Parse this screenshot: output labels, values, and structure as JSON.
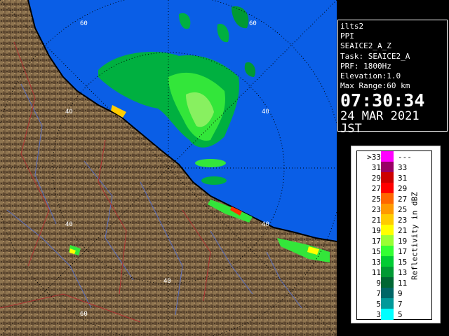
{
  "info": {
    "station": "ilts2",
    "product": "PPI",
    "volume": "SEAICE2_A_Z",
    "task": "Task: SEAICE2_A",
    "prf": "PRF: 1800Hz",
    "elevation": "Elevation:1.0",
    "max_range": "Max Range:60 km",
    "time": "07:30:34",
    "date": "24 MAR 2021 JST"
  },
  "range_labels": [
    "60",
    "60",
    "40",
    "40",
    "40",
    "40",
    "40",
    "60"
  ],
  "legend": {
    "title": "Reflectivity in dBZ",
    "rows": [
      {
        "lo": ">33",
        "hi": "---",
        "color": "#ff00ff"
      },
      {
        "lo": "31",
        "hi": "33",
        "color": "#990066"
      },
      {
        "lo": "29",
        "hi": "31",
        "color": "#cc0000"
      },
      {
        "lo": "27",
        "hi": "29",
        "color": "#ff0000"
      },
      {
        "lo": "25",
        "hi": "27",
        "color": "#ff6600"
      },
      {
        "lo": "23",
        "hi": "25",
        "color": "#ff9900"
      },
      {
        "lo": "21",
        "hi": "23",
        "color": "#ffcc00"
      },
      {
        "lo": "19",
        "hi": "21",
        "color": "#ffff00"
      },
      {
        "lo": "17",
        "hi": "19",
        "color": "#99ff33"
      },
      {
        "lo": "15",
        "hi": "17",
        "color": "#33ff33"
      },
      {
        "lo": "13",
        "hi": "15",
        "color": "#00cc33"
      },
      {
        "lo": "11",
        "hi": "13",
        "color": "#009933"
      },
      {
        "lo": "9",
        "hi": "11",
        "color": "#006633"
      },
      {
        "lo": "7",
        "hi": "9",
        "color": "#006666"
      },
      {
        "lo": "5",
        "hi": "7",
        "color": "#009999"
      },
      {
        "lo": "3",
        "hi": "5",
        "color": "#00ffff"
      }
    ]
  },
  "colors": {
    "sea": "#0a5ee6",
    "land": "#7a6040",
    "coast": "#000000"
  }
}
